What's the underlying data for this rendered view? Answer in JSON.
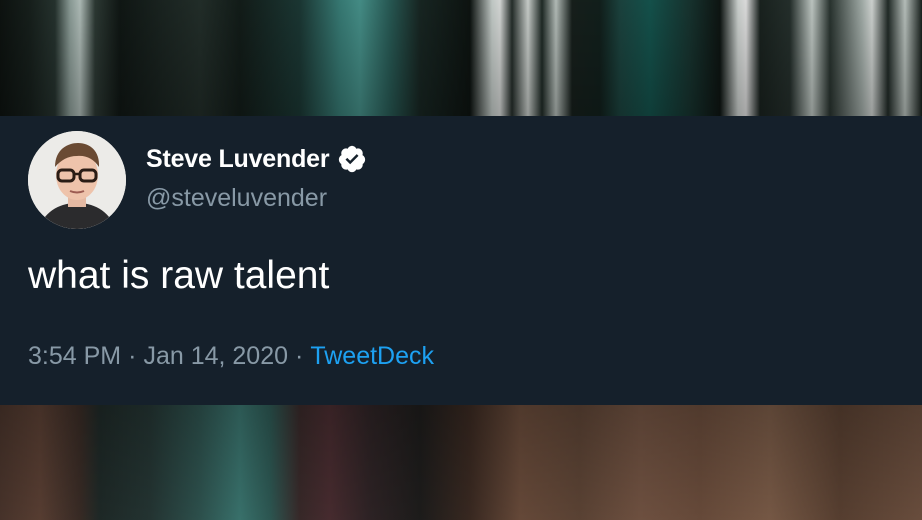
{
  "tweet": {
    "author": {
      "display_name": "Steve Luvender",
      "handle": "@steveluvender",
      "verified": true
    },
    "text": "what is raw talent",
    "time": "3:54 PM",
    "separator": "·",
    "date": "Jan 14, 2020",
    "source": "TweetDeck"
  },
  "colors": {
    "card_background": "#15202b",
    "primary_text": "#ffffff",
    "secondary_text": "#8899a6",
    "link": "#1da1f2"
  },
  "icons": {
    "verified": "verified-badge-icon",
    "avatar": "profile-photo"
  }
}
